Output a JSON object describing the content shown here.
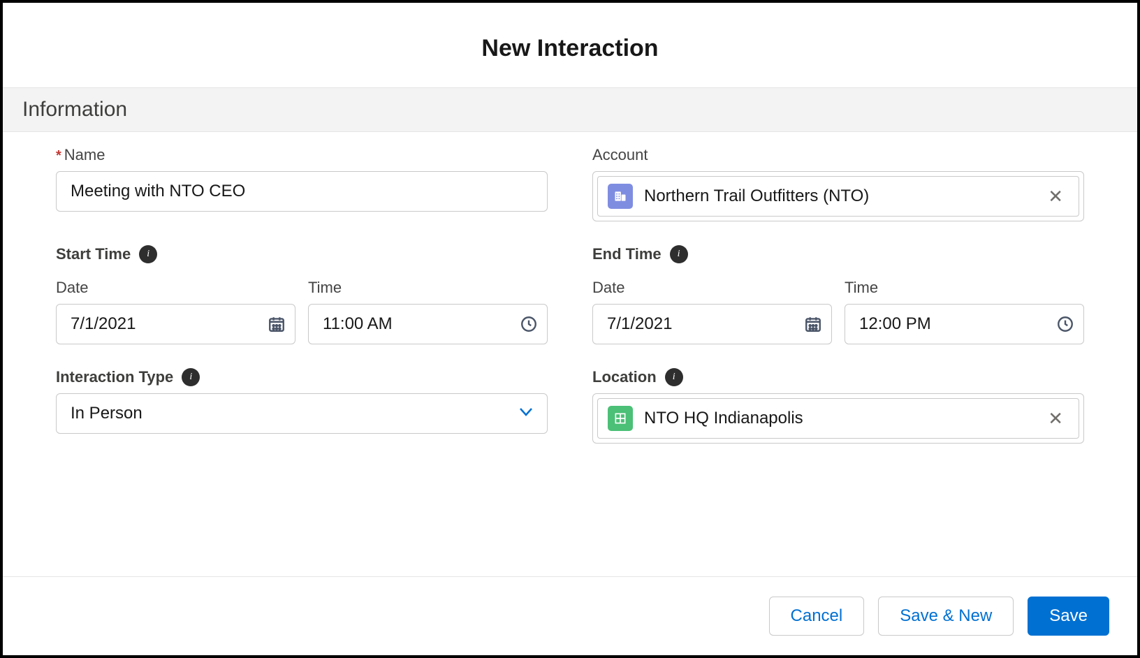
{
  "modal": {
    "title": "New Interaction",
    "section": "Information"
  },
  "fields": {
    "name": {
      "label": "Name",
      "required": true,
      "value": "Meeting with NTO CEO"
    },
    "account": {
      "label": "Account",
      "pill_label": "Northern Trail Outfitters (NTO)"
    },
    "start": {
      "label": "Start Time",
      "date_label": "Date",
      "time_label": "Time",
      "date_value": "7/1/2021",
      "time_value": "11:00 AM"
    },
    "end": {
      "label": "End Time",
      "date_label": "Date",
      "time_label": "Time",
      "date_value": "7/1/2021",
      "time_value": "12:00 PM"
    },
    "interaction_type": {
      "label": "Interaction Type",
      "value": "In Person"
    },
    "location": {
      "label": "Location",
      "pill_label": "NTO HQ Indianapolis"
    }
  },
  "footer": {
    "cancel": "Cancel",
    "save_new": "Save & New",
    "save": "Save"
  }
}
